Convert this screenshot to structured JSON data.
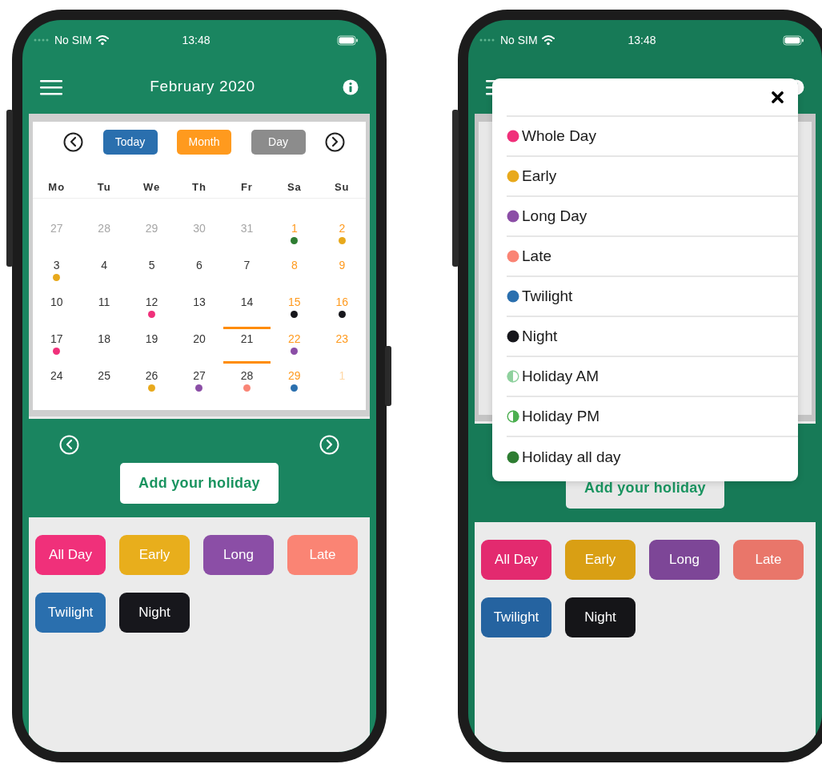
{
  "screens": [
    {
      "status_bar": {
        "carrier": "No SIM",
        "time": "13:48"
      },
      "header": {
        "title": "February 2020"
      },
      "calendar": {
        "view_buttons": [
          {
            "label": "Today",
            "color": "#2a6fae"
          },
          {
            "label": "Month",
            "color": "#ff9a1e"
          },
          {
            "label": "Day",
            "color": "#8c8c8c"
          }
        ],
        "weekdays": [
          "Mo",
          "Tu",
          "We",
          "Th",
          "Fr",
          "Sa",
          "Su"
        ],
        "days": [
          {
            "label": "27",
            "kind": "outside",
            "selected": false
          },
          {
            "label": "28",
            "kind": "outside",
            "selected": false
          },
          {
            "label": "29",
            "kind": "outside",
            "selected": false
          },
          {
            "label": "30",
            "kind": "outside",
            "selected": false
          },
          {
            "label": "31",
            "kind": "outside",
            "selected": false
          },
          {
            "label": "1",
            "kind": "weekend",
            "selected": false,
            "color": "#2e7d32"
          },
          {
            "label": "2",
            "kind": "weekend",
            "selected": false,
            "color": "#e8a91c"
          },
          {
            "label": "3",
            "kind": "weekday",
            "selected": false,
            "color": "#e8a91c"
          },
          {
            "label": "4",
            "kind": "weekday",
            "selected": false
          },
          {
            "label": "5",
            "kind": "weekday",
            "selected": false
          },
          {
            "label": "6",
            "kind": "weekday",
            "selected": false
          },
          {
            "label": "7",
            "kind": "weekday",
            "selected": false
          },
          {
            "label": "8",
            "kind": "weekend",
            "selected": false
          },
          {
            "label": "9",
            "kind": "weekend",
            "selected": false
          },
          {
            "label": "10",
            "kind": "weekday",
            "selected": false
          },
          {
            "label": "11",
            "kind": "weekday",
            "selected": false
          },
          {
            "label": "12",
            "kind": "weekday",
            "selected": false,
            "color": "#f0307a"
          },
          {
            "label": "13",
            "kind": "weekday",
            "selected": false
          },
          {
            "label": "14",
            "kind": "weekday",
            "selected": false
          },
          {
            "label": "15",
            "kind": "weekend",
            "selected": false,
            "color": "#17171c"
          },
          {
            "label": "16",
            "kind": "weekend",
            "selected": false,
            "color": "#17171c"
          },
          {
            "label": "17",
            "kind": "weekday",
            "selected": false,
            "color": "#f0307a"
          },
          {
            "label": "18",
            "kind": "weekday",
            "selected": false
          },
          {
            "label": "19",
            "kind": "weekday",
            "selected": false
          },
          {
            "label": "20",
            "kind": "weekday",
            "selected": false
          },
          {
            "label": "21",
            "kind": "weekday",
            "selected": true
          },
          {
            "label": "22",
            "kind": "weekend",
            "selected": false,
            "color": "#8b4ea6"
          },
          {
            "label": "23",
            "kind": "weekend",
            "selected": false
          },
          {
            "label": "24",
            "kind": "weekday",
            "selected": false
          },
          {
            "label": "25",
            "kind": "weekday",
            "selected": false
          },
          {
            "label": "26",
            "kind": "weekday",
            "selected": false,
            "color": "#e8a91c"
          },
          {
            "label": "27",
            "kind": "weekday",
            "selected": false,
            "color": "#8b4ea6"
          },
          {
            "label": "28",
            "kind": "weekday",
            "selected": false,
            "color": "#f98576"
          },
          {
            "label": "29",
            "kind": "weekend",
            "selected": false,
            "color": "#2a6fae"
          },
          {
            "label": "1",
            "kind": "outside-weekend",
            "selected": false
          }
        ]
      },
      "add_button": {
        "label": "Add your holiday"
      },
      "shifts": [
        {
          "label": "All Day",
          "color": "#f0307a"
        },
        {
          "label": "Early",
          "color": "#e8ae1c"
        },
        {
          "label": "Long",
          "color": "#8b4ea6"
        },
        {
          "label": "Late",
          "color": "#fa8474"
        },
        {
          "label": "Twilight",
          "color": "#2a6fae"
        },
        {
          "label": "Night",
          "color": "#17171c"
        }
      ],
      "popup_open": false
    },
    {
      "status_bar": {
        "carrier": "No SIM",
        "time": "13:48"
      },
      "add_button": {
        "label": "Add your holiday"
      },
      "shifts": [
        {
          "label": "All Day",
          "color": "#e32a6f"
        },
        {
          "label": "Early",
          "color": "#d99f14"
        },
        {
          "label": "Long",
          "color": "#7d4697"
        },
        {
          "label": "Late",
          "color": "#e9766a"
        },
        {
          "label": "Twilight",
          "color": "#2563a0"
        },
        {
          "label": "Night",
          "color": "#151518"
        }
      ],
      "popup_open": true,
      "popup": {
        "items": [
          {
            "label": "Whole Day",
            "kind": "dot",
            "color": "#f0307a"
          },
          {
            "label": "Early",
            "kind": "dot",
            "color": "#e8a91c"
          },
          {
            "label": "Long Day",
            "kind": "dot",
            "color": "#8b4ea6"
          },
          {
            "label": "Late",
            "kind": "dot",
            "color": "#fa8474"
          },
          {
            "label": "Twilight",
            "kind": "dot",
            "color": "#2a6fae"
          },
          {
            "label": "Night",
            "kind": "dot",
            "color": "#17171c"
          },
          {
            "label": "Holiday AM",
            "kind": "halfleft",
            "color": "#8fd19e"
          },
          {
            "label": "Holiday PM",
            "kind": "halfright",
            "color": "#4caf50"
          },
          {
            "label": "Holiday all day",
            "kind": "dot",
            "color": "#2e7d32"
          }
        ]
      }
    }
  ]
}
